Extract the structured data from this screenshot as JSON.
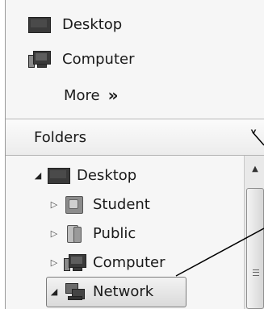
{
  "favorites": {
    "items": [
      {
        "label": "Desktop",
        "icon": "desktop-icon"
      },
      {
        "label": "Computer",
        "icon": "computer-icon"
      }
    ],
    "more_label": "More",
    "more_chevron": "»"
  },
  "folders": {
    "header_label": "Folders",
    "collapse_glyph": "˅",
    "tree": [
      {
        "label": "Desktop",
        "icon": "desktop-icon",
        "expander": "◢",
        "level": 0
      },
      {
        "label": "Student",
        "icon": "user-folder-icon",
        "expander": "▷",
        "level": 1
      },
      {
        "label": "Public",
        "icon": "public-folder-icon",
        "expander": "▷",
        "level": 1
      },
      {
        "label": "Computer",
        "icon": "computer-icon",
        "expander": "▷",
        "level": 1
      },
      {
        "label": "Network",
        "icon": "network-icon",
        "expander": "◢",
        "level": 1,
        "selected": true
      }
    ]
  },
  "scrollbar": {
    "up_glyph": "▲"
  }
}
